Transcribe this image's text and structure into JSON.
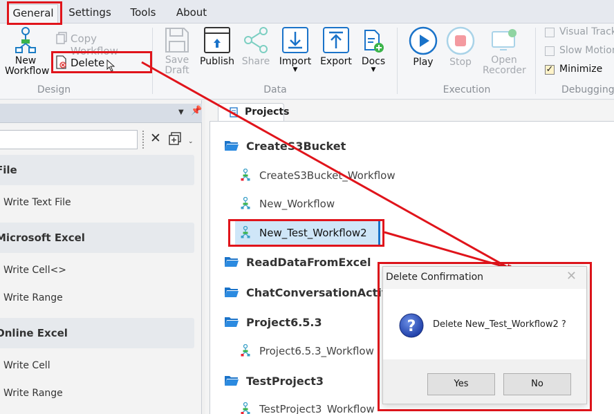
{
  "tabs": [
    {
      "label": "General",
      "active": true
    },
    {
      "label": "Settings",
      "active": false
    },
    {
      "label": "Tools",
      "active": false
    },
    {
      "label": "About",
      "active": false
    }
  ],
  "ribbon": {
    "design": {
      "group_label": "Design",
      "new_workflow": "New Workflow",
      "copy_workflow": "Copy Workflow",
      "delete": "Delete"
    },
    "data": {
      "group_label": "Data",
      "save_draft": "Save Draft",
      "publish": "Publish",
      "share": "Share",
      "import": "Import",
      "export": "Export",
      "docs": "Docs"
    },
    "execution": {
      "group_label": "Execution",
      "play": "Play",
      "stop": "Stop",
      "open_recorder": "Open Recorder"
    },
    "debugging": {
      "group_label": "Debugging",
      "visual_track": "Visual Track",
      "slow_motion": "Slow Motion",
      "minimize": "Minimize",
      "minimize_checked": true
    }
  },
  "left_panel": {
    "search": {
      "value": "",
      "placeholder": ""
    },
    "sections": [
      {
        "title": "File",
        "items": [
          "Write Text File"
        ]
      },
      {
        "title": "Microsoft Excel",
        "items": [
          "Write Cell<>",
          "Write Range"
        ]
      },
      {
        "title": "Online Excel",
        "items": [
          "Write Cell",
          "Write Range"
        ]
      }
    ]
  },
  "projects_tab": "Projects",
  "projects": [
    {
      "name": "CreateS3Bucket",
      "workflows": [
        "CreateS3Bucket_Workflow",
        "New_Workflow",
        "New_Test_Workflow2"
      ]
    },
    {
      "name": "ReadDataFromExcel",
      "workflows": []
    },
    {
      "name": "ChatConversationActivit",
      "workflows": []
    },
    {
      "name": "Project6.5.3",
      "workflows": [
        "Project6.5.3_Workflow"
      ]
    },
    {
      "name": "TestProject3",
      "workflows": [
        "TestProject3_Workflow"
      ]
    }
  ],
  "dialog": {
    "title": "Delete Confirmation",
    "message": "Delete New_Test_Workflow2 ?",
    "yes": "Yes",
    "no": "No"
  },
  "colors": {
    "accent_blue": "#1a73c9",
    "highlight_red": "#e0141b",
    "selected_row": "#cfe6f8"
  }
}
